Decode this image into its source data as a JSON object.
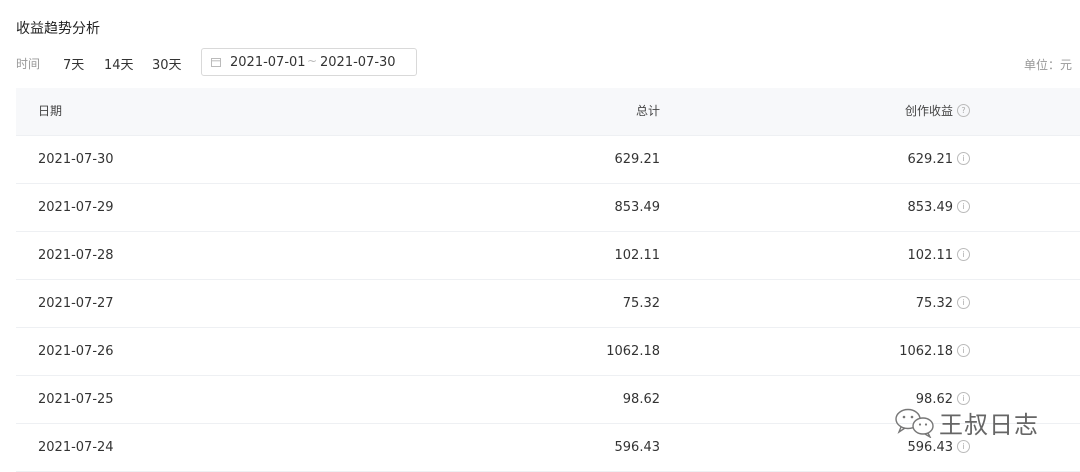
{
  "section_title": "收益趋势分析",
  "filters": {
    "label": "时间",
    "ranges": [
      "7天",
      "14天",
      "30天"
    ],
    "date_start": "2021-07-01",
    "date_separator": "~",
    "date_end": "2021-07-30",
    "unit": "单位：元"
  },
  "table": {
    "headers": {
      "date": "日期",
      "total": "总计",
      "income": "创作收益"
    },
    "rows": [
      {
        "date": "2021-07-30",
        "total": "629.21",
        "income": "629.21"
      },
      {
        "date": "2021-07-29",
        "total": "853.49",
        "income": "853.49"
      },
      {
        "date": "2021-07-28",
        "total": "102.11",
        "income": "102.11"
      },
      {
        "date": "2021-07-27",
        "total": "75.32",
        "income": "75.32"
      },
      {
        "date": "2021-07-26",
        "total": "1062.18",
        "income": "1062.18"
      },
      {
        "date": "2021-07-25",
        "total": "98.62",
        "income": "98.62"
      },
      {
        "date": "2021-07-24",
        "total": "596.43",
        "income": "596.43"
      }
    ]
  },
  "watermark": {
    "text": "王叔日志"
  },
  "colors": {
    "border": "#d9d9d9",
    "header_bg": "#f7f8fa",
    "text": "#333333",
    "muted": "#999999"
  },
  "icons": {
    "calendar": "calendar-icon",
    "help": "question-circle-icon",
    "info": "info-circle-icon",
    "wechat": "wechat-logo-icon"
  }
}
